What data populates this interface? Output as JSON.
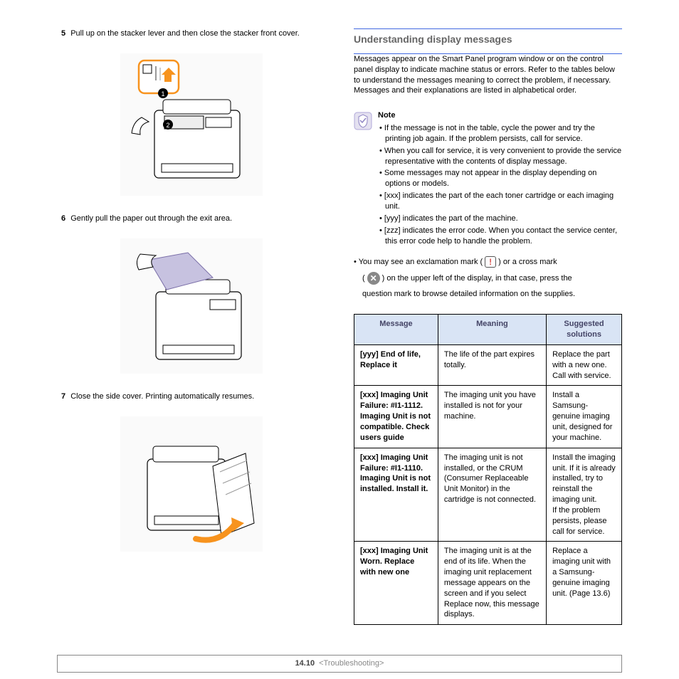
{
  "left": {
    "step5_num": "5",
    "step5_text": "Pull up on the stacker lever and then close the stacker front cover.",
    "step6_num": "6",
    "step6_text": "Gently pull the paper out through the exit area.",
    "step7_num": "7",
    "step7_text": "Close the side cover. Printing automatically resumes."
  },
  "right": {
    "heading": "Understanding display messages",
    "intro": "Messages appear on the Smart Panel program window or on the control panel display to indicate machine status or errors. Refer to the tables below to understand the messages meaning to correct the problem, if necessary. Messages and their explanations are listed in alphabetical order.",
    "note_label": "Note",
    "note_items": [
      "If the message is not in the table, cycle the power and try the printing job again. If the problem persists, call for service.",
      "When you call for service, it is very convenient to provide the service representative with the contents of display message.",
      "Some messages may not appear in the display depending on options or models.",
      "[xxx] indicates the part of the each toner cartridge or each imaging unit.",
      "[yyy] indicates the part of the machine.",
      "[zzz] indicates the error code. When you contact the service center, this error code help to handle the problem."
    ],
    "mark_line_a": "• You may see an exclamation mark (",
    "mark_line_b": ") or a cross mark",
    "mark_line_c": "(",
    "mark_line_d": ") on the upper left of the display, in that case, press the",
    "mark_line_e": "question mark to browse detailed information on the supplies.",
    "table": {
      "headers": [
        "Message",
        "Meaning",
        "Suggested solutions"
      ],
      "rows": [
        {
          "msg": "[yyy] End of life, Replace it",
          "meaning": "The life of the part expires totally.",
          "solution": "Replace the part with a new one. Call with service."
        },
        {
          "msg": "[xxx] Imaging Unit Failure: #I1-1112. Imaging Unit is not compatible. Check users guide",
          "meaning": "The imaging unit you have installed is not for your machine.",
          "solution": "Install a Samsung-genuine imaging unit, designed for your machine."
        },
        {
          "msg": "[xxx] Imaging Unit Failure: #I1-1110. Imaging Unit is not installed. Install it.",
          "meaning": "The imaging unit is not installed, or the CRUM (Consumer Replaceable Unit Monitor) in the cartridge is not connected.",
          "solution": "Install the imaging unit. If it is already installed, try to reinstall the imaging unit.\nIf the problem persists, please call for service."
        },
        {
          "msg": "[xxx] Imaging Unit Worn. Replace with new one",
          "meaning": "The imaging unit is at the end of its life. When the imaging unit replacement message appears on the screen and if you select Replace now, this message displays.",
          "solution": "Replace a imaging unit with a Samsung-genuine imaging unit. (Page 13.6)"
        }
      ]
    }
  },
  "footer": {
    "page": "14.10",
    "section": "<Troubleshooting>"
  }
}
